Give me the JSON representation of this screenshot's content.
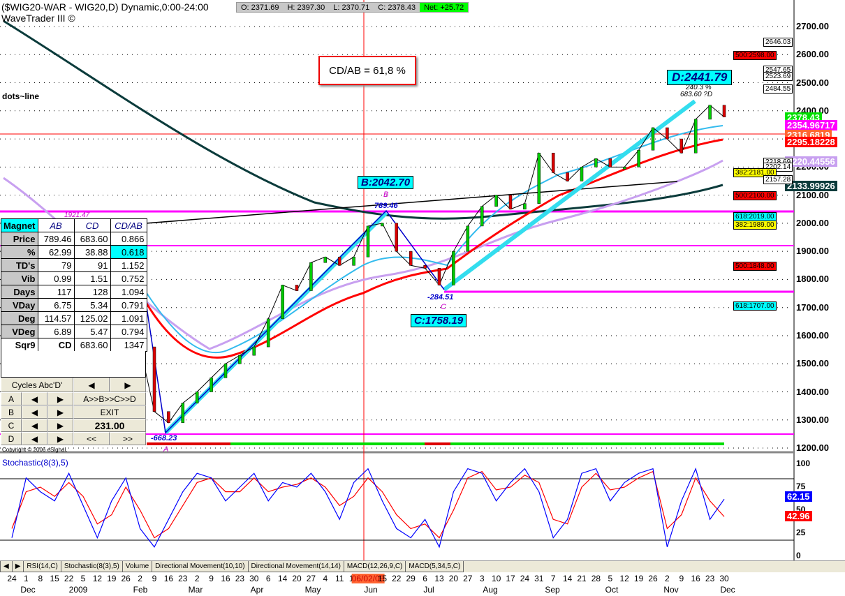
{
  "header": {
    "title": "($WIG20-WAR - WIG20,D) Dynamic,0:00-24:00",
    "subtitle": "WaveTrader III ©",
    "open": "O: 2371.69",
    "high": "H: 2397.30",
    "low": "L: 2370.71",
    "close": "C: 2378.43",
    "net": "Net: +25.72"
  },
  "annotations": {
    "cdab": "CD/AB = 61,8 %",
    "dots_line": "dots~line",
    "d_label": "D:2441.79",
    "d_pct": "240.3 %",
    "d_sub": "683.60 ?D",
    "b_label": "B:2042.70",
    "b_small": "B",
    "b_val": "789.46",
    "c_label": "C:1758.19",
    "c_small": "C",
    "c_val": "-284.51",
    "a_val": "-668.23",
    "a_small": "A",
    "ma_label": "1921.47",
    "copyright": "Copyright © 2006 eSignal."
  },
  "magnet": {
    "headers": [
      "Magnet",
      "AB",
      "CD",
      "CD/AB"
    ],
    "rows": [
      [
        "Price",
        "789.46",
        "683.60",
        "0.866"
      ],
      [
        "%",
        "62.99",
        "38.88",
        "0.618"
      ],
      [
        "TD's",
        "79",
        "91",
        "1.152"
      ],
      [
        "Vib",
        "0.99",
        "1.51",
        "0.752"
      ],
      [
        "Days",
        "117",
        "128",
        "1.094"
      ],
      [
        "VDay",
        "6.75",
        "5.34",
        "0.791"
      ],
      [
        "Deg",
        "114.57",
        "125.02",
        "1.091"
      ],
      [
        "VDeg",
        "6.89",
        "5.47",
        "0.794"
      ],
      [
        "Sqr9",
        "CD",
        "683.60",
        "1347"
      ]
    ]
  },
  "buttons": {
    "cycles": "Cycles Abc'D'",
    "prev": "◀",
    "next": "▶",
    "a": "A",
    "b": "B",
    "c": "C",
    "d": "D",
    "abcd": "A>>B>>C>>D",
    "exit": "EXIT",
    "value": "231.00",
    "rew": "<<",
    "fwd": ">>"
  },
  "price_tags": [
    {
      "text": "2378.43",
      "color": "#00e000",
      "p": 2378
    },
    {
      "text": "2354.96717",
      "color": "#ff00ff",
      "p": 2350
    },
    {
      "text": "2316.6819",
      "color": "#ff6633",
      "p": 2316
    },
    {
      "text": "2295.18228",
      "color": "#ff0000",
      "p": 2290
    },
    {
      "text": "2220.44556",
      "color": "#c8a0f0",
      "p": 2220
    },
    {
      "text": "2133.99926",
      "color": "#0b3b3b",
      "p": 2134
    }
  ],
  "fib_tags": [
    {
      "text": "2646.03",
      "bg": "#ffffff",
      "p": 2646,
      "col": 1
    },
    {
      "text": "500:2598.00",
      "bg": "#ff0000",
      "p": 2598,
      "col": 0
    },
    {
      "text": "2547.65",
      "bg": "#ffffff",
      "p": 2547,
      "col": 1
    },
    {
      "text": "2523.69",
      "bg": "#ffffff",
      "p": 2523,
      "col": 1
    },
    {
      "text": "2484.55",
      "bg": "#ffffff",
      "p": 2480,
      "col": 1
    },
    {
      "text": "2218.69",
      "bg": "#ffffff",
      "p": 2219,
      "col": 1
    },
    {
      "text": "2202.14",
      "bg": "#ffffff",
      "p": 2202,
      "col": 1
    },
    {
      "text": "382:2181.00",
      "bg": "#ffff00",
      "p": 2181,
      "col": 0
    },
    {
      "text": "2157.28",
      "bg": "#ffffff",
      "p": 2157,
      "col": 1
    },
    {
      "text": "500:2100.00",
      "bg": "#ff0000",
      "p": 2100,
      "col": 0
    },
    {
      "text": "618:2019.00",
      "bg": "#00ffff",
      "p": 2024,
      "col": 0
    },
    {
      "text": "382:1989.00",
      "bg": "#ffff00",
      "p": 1994,
      "col": 0
    },
    {
      "text": "500:1848.00",
      "bg": "#ff0000",
      "p": 1848,
      "col": 0
    },
    {
      "text": "618:1707.00",
      "bg": "#00ffff",
      "p": 1707,
      "col": 0
    }
  ],
  "stoch": {
    "label": "Stochastic(8(3),5)",
    "k_tag": "62.15",
    "d_tag": "42.96",
    "ticks": [
      "100",
      "75",
      "50",
      "25",
      "0"
    ]
  },
  "tabs": [
    "RSI(14,C)",
    "Stochastic(8(3),5)",
    "Volume",
    "Directional Movement(10,10)",
    "Directional Movement(14,14)",
    "MACD(12,26,9,C)",
    "MACD(5,34,5,C)"
  ],
  "chart_data": {
    "type": "candlestick",
    "title": "($WIG20-WAR - WIG20,D) Dynamic,0:00-24:00",
    "ylim": [
      1200,
      2700
    ],
    "yticks": [
      "2700.00",
      "2600.00",
      "2500.00",
      "2400.00",
      "2300.00",
      "2200.00",
      "2100.00",
      "2000.00",
      "1900.00",
      "1800.00",
      "1700.00",
      "1600.00",
      "1500.00",
      "1400.00",
      "1300.00",
      "1200.00"
    ],
    "x": [
      "24",
      "1",
      "8",
      "15",
      "22",
      "5",
      "12",
      "19",
      "26",
      "2",
      "9",
      "16",
      "23",
      "2",
      "9",
      "16",
      "23",
      "30",
      "6",
      "14",
      "20",
      "27",
      "4",
      "11",
      "18",
      "06/02/09",
      "15",
      "22",
      "29",
      "6",
      "13",
      "20",
      "27",
      "3",
      "10",
      "17",
      "24",
      "31",
      "7",
      "14",
      "21",
      "28",
      "5",
      "12",
      "19",
      "26",
      "2",
      "9",
      "16",
      "23",
      "30"
    ],
    "months": [
      "Dec",
      "2009",
      "Feb",
      "Mar",
      "Apr",
      "May",
      "Jun",
      "Jul",
      "Aug",
      "Sep",
      "Oct",
      "Nov",
      "Dec"
    ],
    "close": [
      1720,
      1800,
      1780,
      1820,
      1850,
      1900,
      1800,
      1700,
      1620,
      1560,
      1330,
      1290,
      1360,
      1400,
      1450,
      1500,
      1530,
      1560,
      1660,
      1780,
      1760,
      1860,
      1880,
      1850,
      1880,
      1990,
      2000,
      1900,
      1850,
      1840,
      1780,
      1900,
      1990,
      2060,
      2100,
      2050,
      2070,
      2250,
      2180,
      2150,
      2200,
      2230,
      2200,
      2200,
      2260,
      2340,
      2300,
      2250,
      2370,
      2420,
      2378
    ],
    "stoch_k": [
      20,
      85,
      70,
      60,
      90,
      55,
      20,
      60,
      85,
      30,
      10,
      40,
      70,
      90,
      85,
      60,
      75,
      90,
      60,
      80,
      75,
      90,
      70,
      40,
      80,
      95,
      60,
      30,
      20,
      40,
      10,
      70,
      95,
      90,
      60,
      80,
      95,
      70,
      20,
      40,
      90,
      95,
      60,
      80,
      90,
      95,
      10,
      60,
      95,
      40,
      62
    ],
    "stoch_d": [
      30,
      70,
      75,
      65,
      80,
      65,
      35,
      45,
      75,
      50,
      20,
      30,
      55,
      80,
      85,
      70,
      70,
      85,
      70,
      75,
      78,
      85,
      75,
      55,
      65,
      85,
      70,
      45,
      30,
      35,
      20,
      50,
      85,
      92,
      72,
      75,
      88,
      80,
      40,
      35,
      75,
      90,
      72,
      75,
      85,
      92,
      30,
      45,
      85,
      60,
      43
    ]
  }
}
